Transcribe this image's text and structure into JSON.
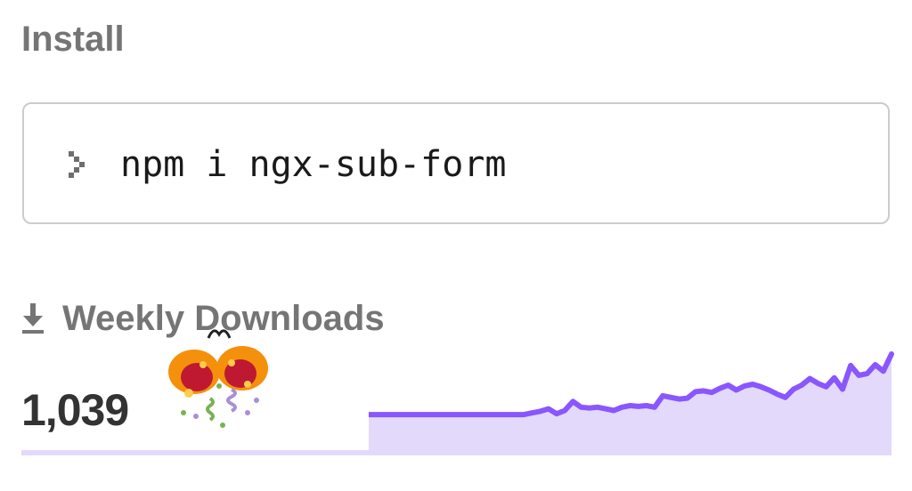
{
  "install": {
    "title": "Install",
    "command": "npm i ngx-sub-form"
  },
  "weekly_downloads": {
    "label": "Weekly Downloads",
    "count": "1,039",
    "trend": [
      0.26,
      0.26,
      0.26,
      0.26,
      0.26,
      0.26,
      0.26,
      0.26,
      0.26,
      0.26,
      0.26,
      0.26,
      0.26,
      0.26,
      0.26,
      0.26,
      0.26,
      0.26,
      0.26,
      0.26,
      0.28,
      0.3,
      0.33,
      0.27,
      0.31,
      0.42,
      0.35,
      0.34,
      0.35,
      0.33,
      0.31,
      0.35,
      0.37,
      0.36,
      0.37,
      0.35,
      0.49,
      0.47,
      0.45,
      0.46,
      0.54,
      0.55,
      0.53,
      0.58,
      0.62,
      0.56,
      0.61,
      0.63,
      0.6,
      0.56,
      0.51,
      0.47,
      0.57,
      0.62,
      0.7,
      0.64,
      0.6,
      0.71,
      0.57,
      0.86,
      0.74,
      0.76,
      0.87,
      0.79,
      1.0
    ],
    "line_color": "#8956ff",
    "fill_color": "#e3d9fb"
  },
  "icons": {
    "prompt": "prompt-chevron-icon",
    "download": "download-arrow-icon",
    "celebration": "party-popper-icon"
  }
}
